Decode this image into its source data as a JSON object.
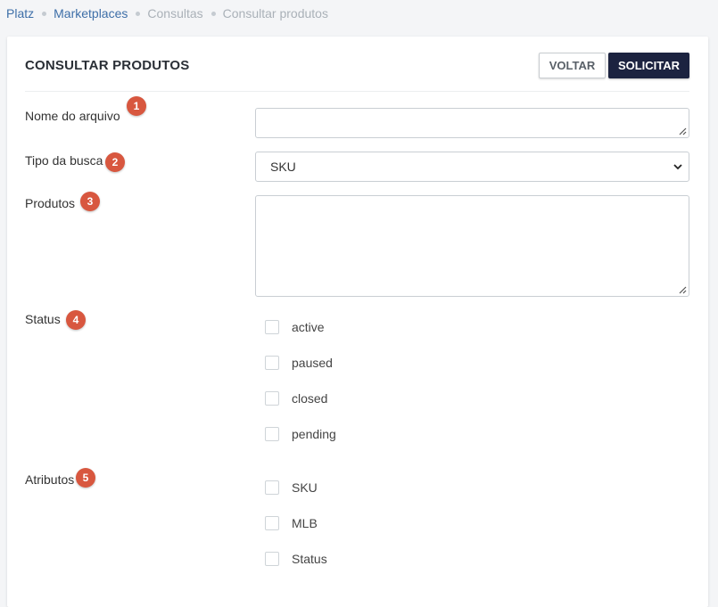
{
  "breadcrumb": {
    "items": [
      "Platz",
      "Marketplaces",
      "Consultas",
      "Consultar produtos"
    ]
  },
  "card": {
    "title": "CONSULTAR PRODUTOS",
    "back_label": "VOLTAR",
    "submit_label": "SOLICITAR"
  },
  "form": {
    "file_name": {
      "label": "Nome do arquivo",
      "badge": "1",
      "value": ""
    },
    "search_type": {
      "label": "Tipo da busca",
      "badge": "2",
      "selected": "SKU"
    },
    "products": {
      "label": "Produtos",
      "badge": "3",
      "value": ""
    },
    "status": {
      "label": "Status",
      "badge": "4",
      "options": [
        "active",
        "paused",
        "closed",
        "pending"
      ]
    },
    "attributes": {
      "label": "Atributos",
      "badge": "5",
      "options": [
        "SKU",
        "MLB",
        "Status"
      ]
    }
  },
  "colors": {
    "accent_dark": "#1c2340",
    "badge": "#d8573f",
    "link": "#3e6fa8"
  }
}
